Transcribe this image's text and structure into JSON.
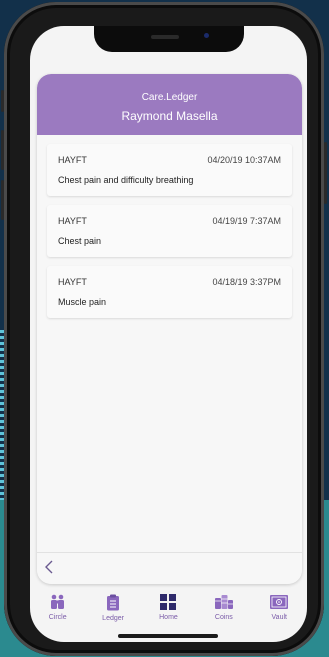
{
  "colors": {
    "accent": "#9b7ac0",
    "tab_icon": "#8a67bd",
    "home_icon": "#2f2a6b"
  },
  "header": {
    "app_name": "Care.Ledger",
    "patient_name": "Raymond Masella"
  },
  "entries": [
    {
      "source": "HAYFT",
      "timestamp": "04/20/19 10:37AM",
      "description": "Chest pain and difficulty breathing"
    },
    {
      "source": "HAYFT",
      "timestamp": "04/19/19 7:37AM",
      "description": "Chest pain"
    },
    {
      "source": "HAYFT",
      "timestamp": "04/18/19 3:37PM",
      "description": "Muscle pain"
    }
  ],
  "back_icon": "chevron-left-icon",
  "tabs": [
    {
      "label": "Circle",
      "icon": "people-icon"
    },
    {
      "label": "Ledger",
      "icon": "clipboard-icon"
    },
    {
      "label": "Home",
      "icon": "grid-icon"
    },
    {
      "label": "Coins",
      "icon": "coins-icon"
    },
    {
      "label": "Vault",
      "icon": "safe-icon"
    }
  ]
}
